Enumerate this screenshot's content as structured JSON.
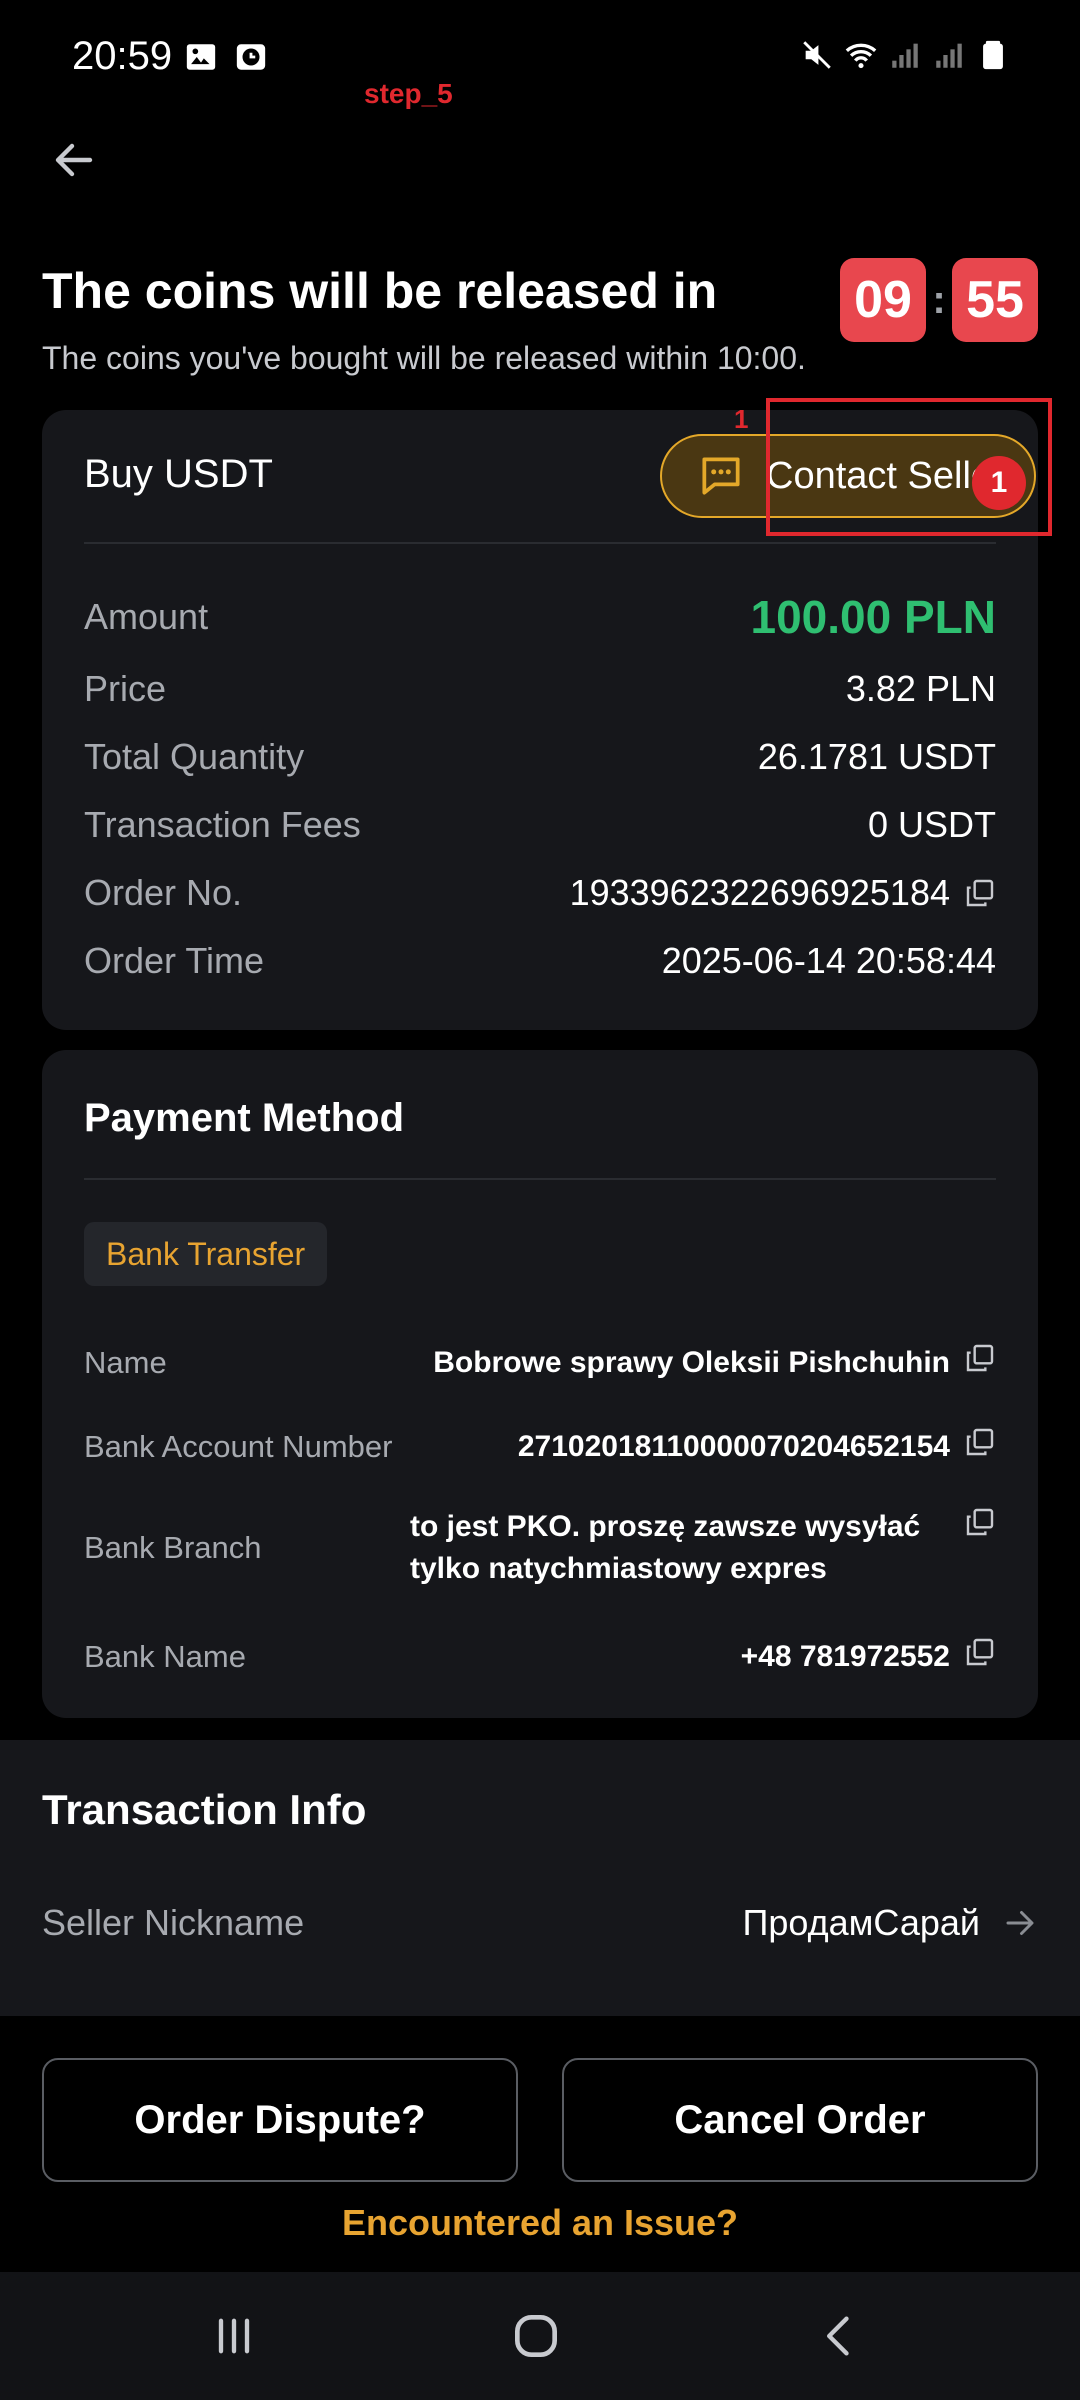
{
  "status_bar": {
    "time": "20:59"
  },
  "annotations": {
    "step": "step_5",
    "marker": "1"
  },
  "header": {
    "title": "The coins will be released in",
    "subtitle": "The coins you've bought will be released within 10:00.",
    "timer_minutes": "09",
    "timer_separator": ":",
    "timer_seconds": "55"
  },
  "order": {
    "title": "Buy USDT",
    "contact_label": "Contact Seller",
    "contact_badge": "1",
    "rows": [
      {
        "label": "Amount",
        "value": "100.00 PLN"
      },
      {
        "label": "Price",
        "value": "3.82 PLN"
      },
      {
        "label": "Total Quantity",
        "value": "26.1781 USDT"
      },
      {
        "label": "Transaction Fees",
        "value": "0 USDT"
      },
      {
        "label": "Order No.",
        "value": "1933962322696925184"
      },
      {
        "label": "Order Time",
        "value": "2025-06-14 20:58:44"
      }
    ]
  },
  "payment": {
    "title": "Payment Method",
    "method_tag": "Bank Transfer",
    "rows": [
      {
        "label": "Name",
        "value": "Bobrowe sprawy Oleksii Pishchuhin"
      },
      {
        "label": "Bank Account Number",
        "value": "27102018110000070204652154"
      },
      {
        "label": "Bank Branch",
        "value": "to jest PKO. proszę zawsze wysyłać tylko natychmiastowy expres"
      },
      {
        "label": "Bank Name",
        "value": "+48 781972552"
      }
    ]
  },
  "transaction_info": {
    "title": "Transaction Info",
    "seller_label": "Seller Nickname",
    "seller_value": "ПродамСарай"
  },
  "actions": {
    "dispute_label": "Order Dispute?",
    "cancel_label": "Cancel Order",
    "issue_link": "Encountered an Issue?"
  },
  "colors": {
    "accent": "#e8a431",
    "timer": "#e8474e",
    "amount_green": "#2fbf71",
    "annotation_red": "#e0282e"
  }
}
